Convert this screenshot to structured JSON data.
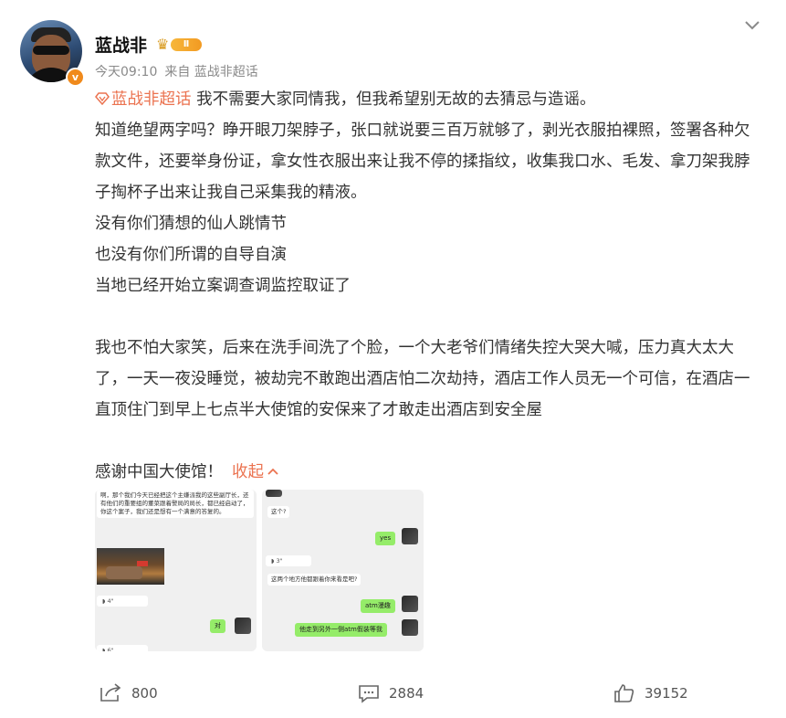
{
  "user": {
    "name": "蓝战非",
    "level_badge": "Ⅱ",
    "verified_mark": "v"
  },
  "meta": {
    "time": "今天09:10",
    "source": "来自 蓝战非超话"
  },
  "post": {
    "supertopic": "蓝战非超话",
    "line1_rest": " 我不需要大家同情我，但我希望别无故的去猜忌与造谣。",
    "para1": "知道绝望两字吗？睁开眼刀架脖子，张口就说要三百万就够了，剥光衣服拍裸照，签署各种欠款文件，还要举身份证，拿女性衣服出来让我不停的揉指纹，收集我口水、毛发、拿刀架我脖子掏杯子出来让我自己采集我的精液。",
    "line_a": "没有你们猜想的仙人跳情节",
    "line_b": "也没有你们所谓的自导自演",
    "line_c": "当地已经开始立案调查调监控取证了",
    "para2": "我也不怕大家笑，后来在洗手间洗了个脸，一个大老爷们情绪失控大哭大喊，压力真大太大了，一天一夜没睡觉，被劫完不敢跑出酒店怕二次劫持，酒店工作人员无一个可信，在酒店一直顶住门到早上七点半大使馆的安保来了才敢走出酒店到安全屋",
    "thanks": "感谢中国大使馆！",
    "collapse_label": "收起"
  },
  "images": {
    "img1": {
      "msg1": "啊，那个我们今天已经把这个主嫌派我的这些副厅长，还有他们的重要组的董菜跟着警局的局长，都已经启动了，你这个案子，我们还是想有一个满意的答复的。",
      "voice1": "4\"",
      "reply1": "对",
      "voice2": "6\""
    },
    "img2": {
      "msg1": "这个?",
      "reply1": "yes",
      "voice1": "3\"",
      "msg2": "这两个地方他都跟着你来看是吧?",
      "reply2": "atm漫趣",
      "reply3": "他走到另外一侧atm假装等我"
    }
  },
  "footer": {
    "repost_count": "800",
    "comment_count": "2884",
    "like_count": "39152"
  },
  "colors": {
    "accent": "#eb7350",
    "text": "#333333",
    "meta": "#8a8a8a",
    "wechat_green": "#95ec69"
  },
  "icons": [
    "chevron-down-icon",
    "crown-icon",
    "supertopic-icon",
    "repost-icon",
    "comment-icon",
    "like-icon",
    "voice-icon"
  ]
}
